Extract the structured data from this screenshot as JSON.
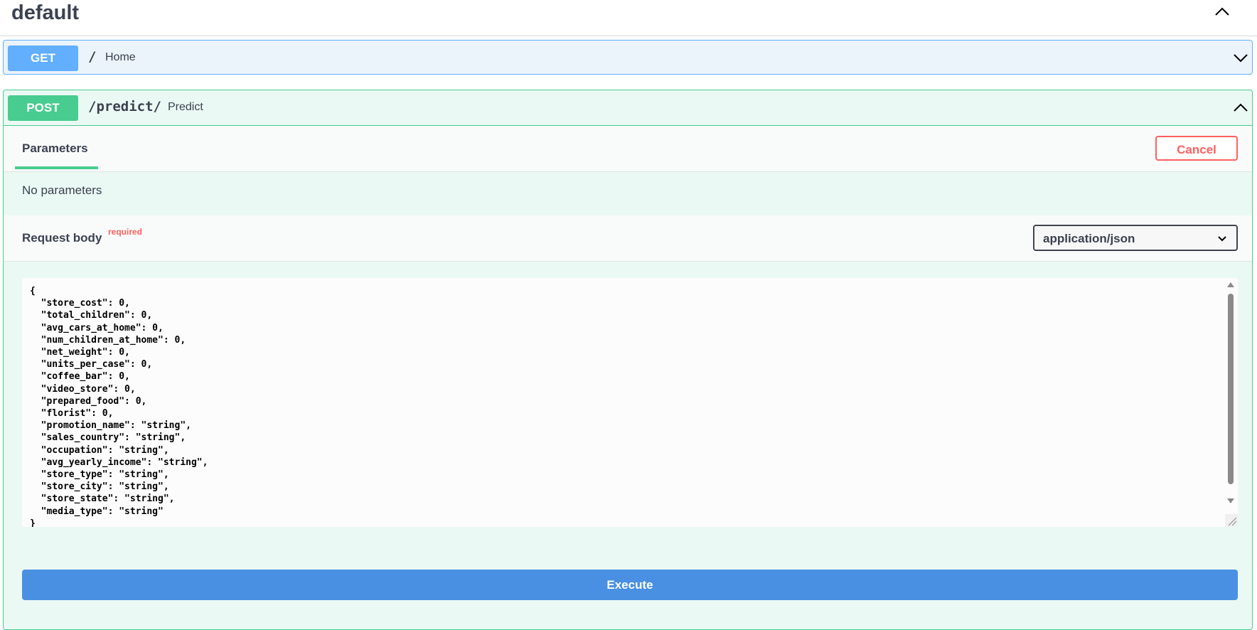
{
  "section": {
    "title": "default"
  },
  "get_op": {
    "method": "GET",
    "path": "/",
    "summary": "Home"
  },
  "post_op": {
    "method": "POST",
    "path": "/predict/",
    "summary": "Predict",
    "tab_label": "Parameters",
    "cancel_label": "Cancel",
    "no_params_text": "No parameters",
    "request_body_label": "Request body",
    "required_label": "required",
    "content_type": "application/json",
    "body_text": "{\n  \"store_cost\": 0,\n  \"total_children\": 0,\n  \"avg_cars_at_home\": 0,\n  \"num_children_at_home\": 0,\n  \"net_weight\": 0,\n  \"units_per_case\": 0,\n  \"coffee_bar\": 0,\n  \"video_store\": 0,\n  \"prepared_food\": 0,\n  \"florist\": 0,\n  \"promotion_name\": \"string\",\n  \"sales_country\": \"string\",\n  \"occupation\": \"string\",\n  \"avg_yearly_income\": \"string\",\n  \"store_type\": \"string\",\n  \"store_city\": \"string\",\n  \"store_state\": \"string\",\n  \"media_type\": \"string\"\n}",
    "execute_label": "Execute"
  },
  "icons": {
    "section_toggle": "chevron-up-icon",
    "get_toggle": "chevron-down-icon",
    "post_toggle": "chevron-up-icon",
    "select_arrow": "chevron-down-icon"
  },
  "colors": {
    "get": "#61affe",
    "post": "#49cc90",
    "cancel": "#ff6060",
    "execute": "#4990e2"
  }
}
